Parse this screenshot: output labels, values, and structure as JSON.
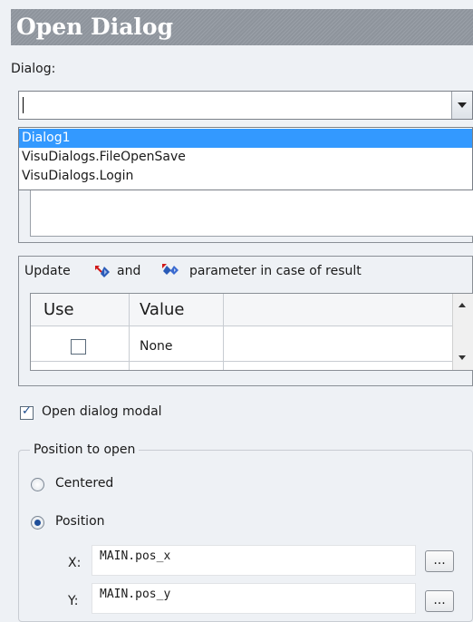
{
  "window": {
    "title": "Open Dialog"
  },
  "dialog_field": {
    "label": "Dialog:",
    "value": "",
    "options": [
      "Dialog1",
      "VisuDialogs.FileOpenSave",
      "VisuDialogs.Login"
    ],
    "selected": "Dialog1"
  },
  "update_group": {
    "prefix": "Update",
    "and": "and",
    "suffix": "parameter in case of result",
    "columns": [
      "Use",
      "Value"
    ],
    "rows": [
      {
        "use": false,
        "value": "None"
      }
    ]
  },
  "modal": {
    "label": "Open dialog modal",
    "checked": true
  },
  "position_group": {
    "legend": "Position to open",
    "centered_label": "Centered",
    "position_label": "Position",
    "selected": "Position",
    "x_label": "X:",
    "x_value": "MAIN.pos_x",
    "y_label": "Y:",
    "y_value": "MAIN.pos_y",
    "browse_label": "..."
  },
  "colors": {
    "selection": "#3399ff",
    "titlebar": "#949aa2",
    "background": "#eef1f5"
  },
  "icons": [
    "dropdown-arrow-icon",
    "red-arrow-diamond-icon",
    "blue-double-diamond-icon",
    "checkmark-icon",
    "scroll-up-icon",
    "scroll-down-icon"
  ]
}
